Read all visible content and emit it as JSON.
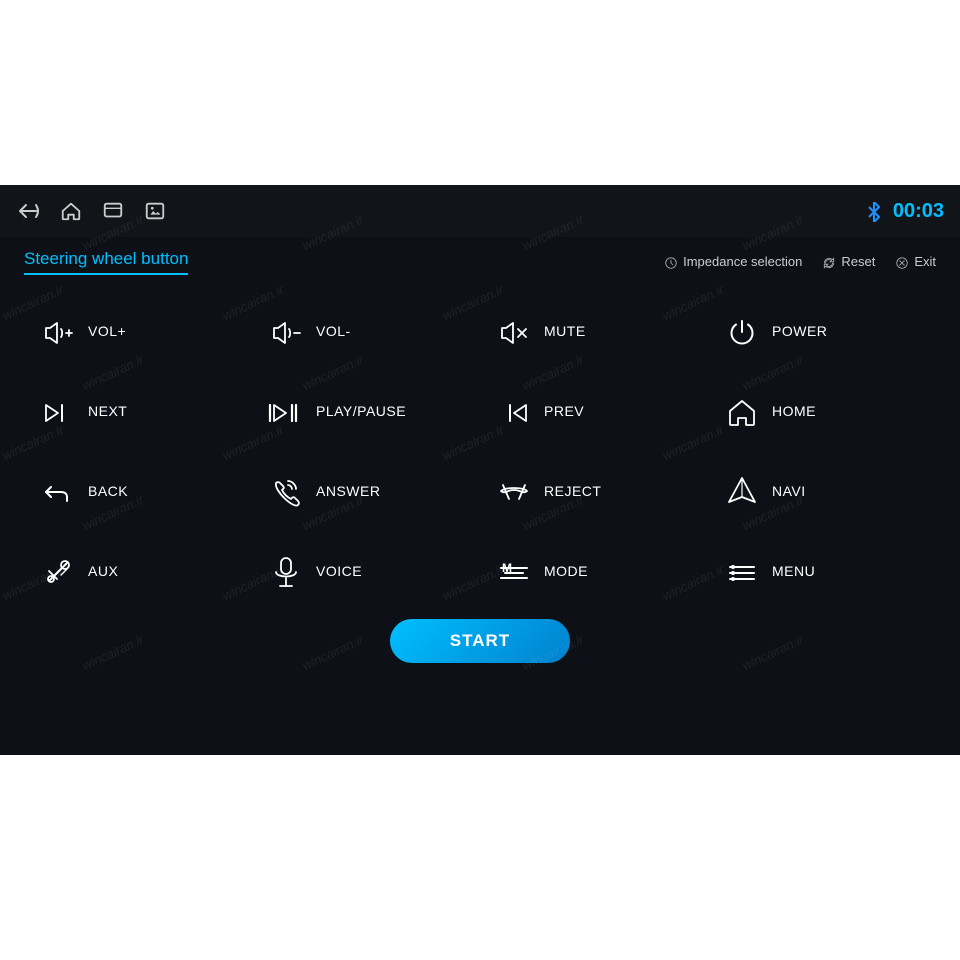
{
  "app": {
    "title": "Steering wheel button",
    "time": "00:03"
  },
  "navbar": {
    "icons": [
      "back-icon",
      "home-icon",
      "multiwindow-icon",
      "screenshot-icon"
    ],
    "bluetooth_icon": "bluetooth-icon",
    "time_label": "00:03"
  },
  "title_actions": [
    {
      "icon": "impedance-icon",
      "label": "Impedance selection"
    },
    {
      "icon": "reset-icon",
      "label": "Reset"
    },
    {
      "icon": "exit-icon",
      "label": "Exit"
    }
  ],
  "buttons": [
    {
      "icon": "vol-plus-icon",
      "label": "VOL+"
    },
    {
      "icon": "vol-minus-icon",
      "label": "VOL-"
    },
    {
      "icon": "mute-icon",
      "label": "MUTE"
    },
    {
      "icon": "power-icon",
      "label": "POWER"
    },
    {
      "icon": "next-icon",
      "label": "NEXT"
    },
    {
      "icon": "play-pause-icon",
      "label": "PLAY/PAUSE"
    },
    {
      "icon": "prev-icon",
      "label": "PREV"
    },
    {
      "icon": "home-icon",
      "label": "HOME"
    },
    {
      "icon": "back-icon",
      "label": "BACK"
    },
    {
      "icon": "answer-icon",
      "label": "ANSWER"
    },
    {
      "icon": "reject-icon",
      "label": "REJECT"
    },
    {
      "icon": "navi-icon",
      "label": "NAVI"
    },
    {
      "icon": "aux-icon",
      "label": "AUX"
    },
    {
      "icon": "voice-icon",
      "label": "VOICE"
    },
    {
      "icon": "mode-icon",
      "label": "MODE"
    },
    {
      "icon": "menu-icon",
      "label": "MENU"
    }
  ],
  "start_button": {
    "label": "START"
  }
}
